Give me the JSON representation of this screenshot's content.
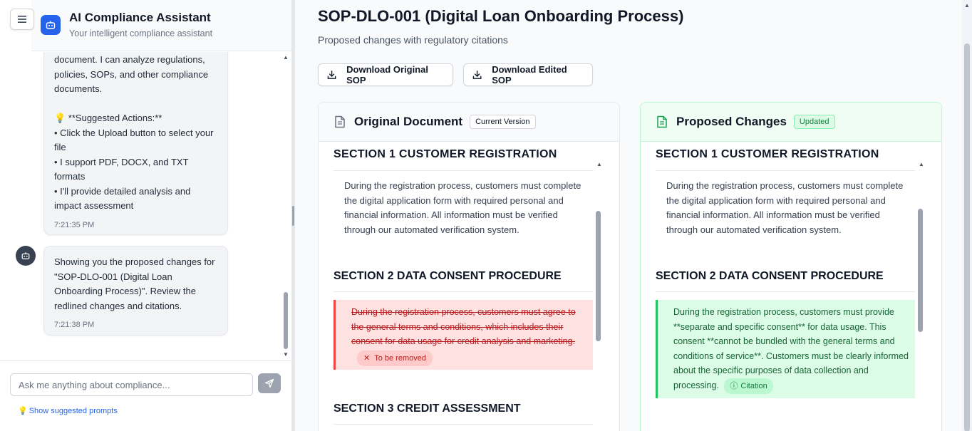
{
  "sidebar": {
    "app_title": "AI Compliance Assistant",
    "app_subtitle": "Your intelligent compliance assistant",
    "messages": [
      {
        "text": "document. I can analyze regulations, policies, SOPs, and other compliance documents.\n\n💡 **Suggested Actions:**\n• Click the Upload button to select your file\n• I support PDF, DOCX, and TXT formats\n• I'll provide detailed analysis and impact assessment",
        "time": "7:21:35 PM"
      },
      {
        "text": "Showing you the proposed changes for \"SOP-DLO-001 (Digital Loan Onboarding Process)\". Review the redlined changes and citations.",
        "time": "7:21:38 PM"
      }
    ],
    "input_placeholder": "Ask me anything about compliance...",
    "suggest_label": "Show suggested prompts"
  },
  "main": {
    "title": "SOP-DLO-001 (Digital Loan Onboarding Process)",
    "subtitle": "Proposed changes with regulatory citations",
    "download_original": "Download Original SOP",
    "download_edited": "Download Edited SOP",
    "original": {
      "title": "Original Document",
      "badge": "Current Version",
      "section1_heading": "SECTION 1 CUSTOMER REGISTRATION",
      "section1_text": "During the registration process, customers must complete the digital application form with required personal and financial information. All information must be verified through our automated verification system.",
      "section2_heading": "SECTION 2 DATA CONSENT PROCEDURE",
      "removed_text": "During the registration process, customers must agree to the general terms and conditions, which includes their consent for data usage for credit analysis and marketing.",
      "removed_tag": "To be removed",
      "section3_heading": "SECTION 3 CREDIT ASSESSMENT"
    },
    "proposed": {
      "title": "Proposed Changes",
      "badge": "Updated",
      "section1_heading": "SECTION 1 CUSTOMER REGISTRATION",
      "section1_text": "During the registration process, customers must complete the digital application form with required personal and financial information. All information must be verified through our automated verification system.",
      "section2_heading": "SECTION 2 DATA CONSENT PROCEDURE",
      "added_text": "During the registration process, customers must provide **separate and specific consent** for data usage. This consent **cannot be bundled with the general terms and conditions of service**. Customers must be clearly informed about the specific purposes of data collection and processing.",
      "citation_tag": "Citation"
    }
  },
  "colors": {
    "accent": "#2563eb",
    "removed_bg": "#fee2e2",
    "removed_text": "#b91c1c",
    "added_bg": "#dcfce7",
    "added_text": "#166534"
  }
}
